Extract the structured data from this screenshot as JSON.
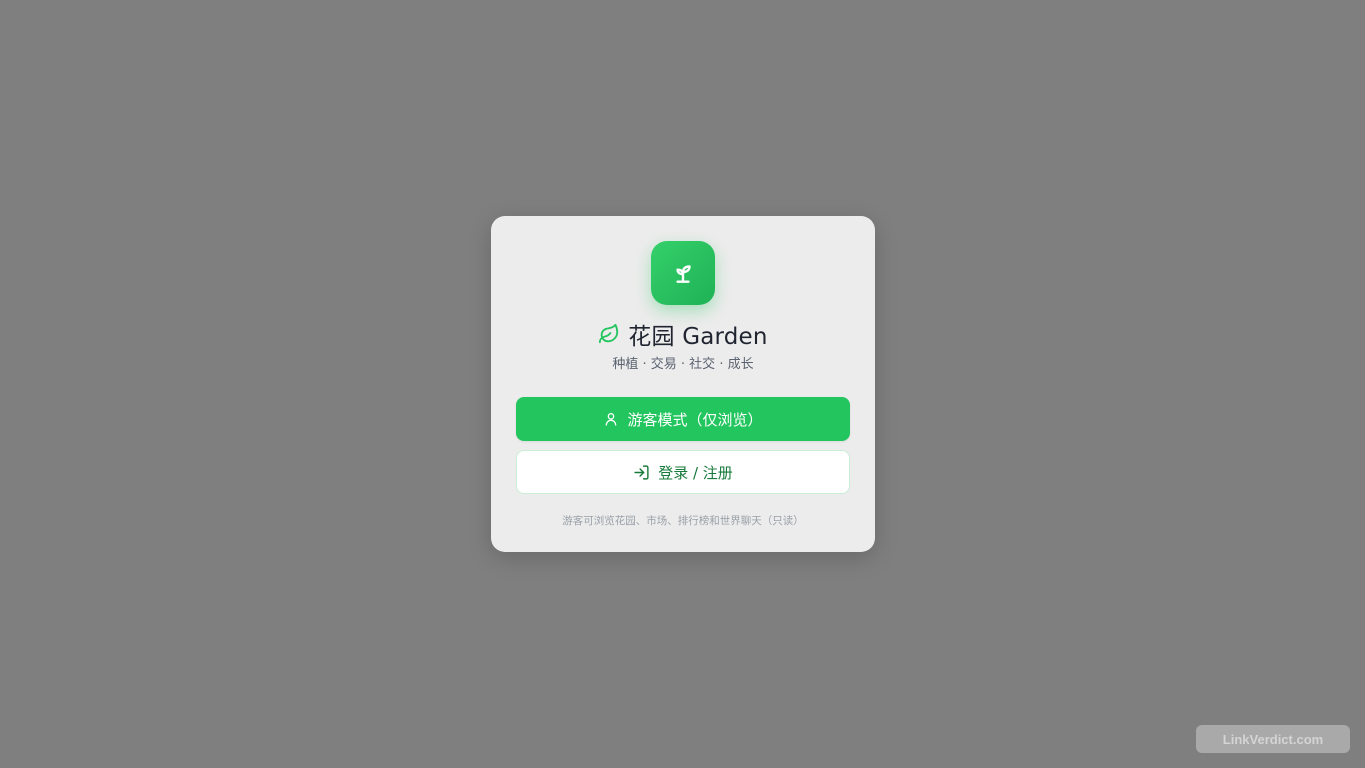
{
  "app": {
    "title": "花园 Garden",
    "subtitle": "种植 · 交易 · 社交 · 成长",
    "logo_icon": "sprout-icon",
    "title_icon": "leaf-icon",
    "accent_color": "#22c55e"
  },
  "actions": {
    "guest_label": "游客模式（仅浏览）",
    "guest_icon": "user-icon",
    "login_label": "登录 / 注册",
    "login_icon": "login-icon"
  },
  "note": "游客可浏览花园、市场、排行榜和世界聊天（只读）",
  "watermark": "LinkVerdict.com"
}
